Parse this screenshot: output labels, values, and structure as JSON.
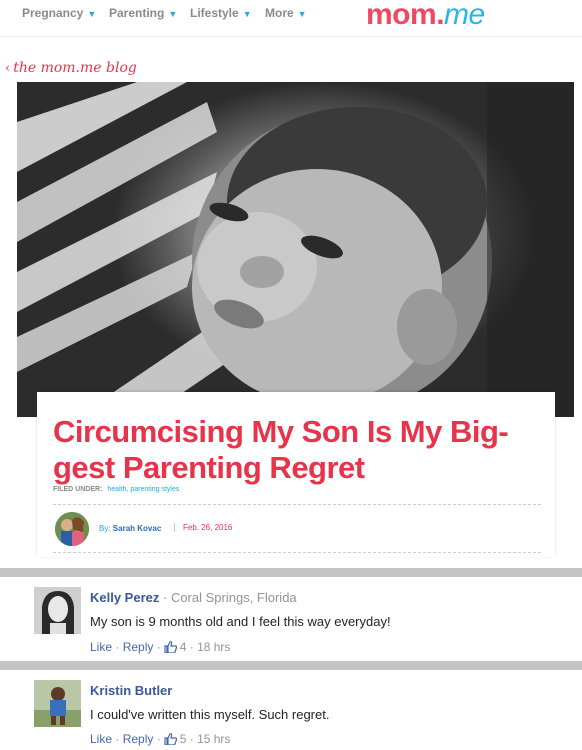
{
  "nav": {
    "items": [
      {
        "label": "Pregnancy"
      },
      {
        "label": "Parenting"
      },
      {
        "label": "Lifestyle"
      },
      {
        "label": "More"
      }
    ],
    "logo": {
      "part1": "mom",
      "dot": ".",
      "part2": "me"
    }
  },
  "blog_link": "the mom.me blog",
  "article": {
    "title": "Circumcising My Son Is My Biggest Parenting Regret",
    "title_line1": "Circumcising My Son Is My Big-",
    "title_line2": "gest Parenting Regret",
    "filed_under_label": "FILED UNDER:",
    "tags": "health, parenting styles",
    "by_label": "By:",
    "author": "Sarah Kovac",
    "date": "Feb. 26, 2016"
  },
  "comments": [
    {
      "name": "Kelly Perez",
      "location": "Coral Springs, Florida",
      "text": "My son is 9 months old and I feel this way everyday!",
      "like_label": "Like",
      "reply_label": "Reply",
      "likes": "4",
      "time": "18 hrs"
    },
    {
      "name": "Kristin Butler",
      "location": "",
      "text": "I could've written this myself. Such regret.",
      "like_label": "Like",
      "reply_label": "Reply",
      "likes": "5",
      "time": "15 hrs"
    }
  ],
  "colors": {
    "brand_red": "#e8334a",
    "brand_blue": "#29a8e0",
    "fb_blue": "#4267b2"
  }
}
